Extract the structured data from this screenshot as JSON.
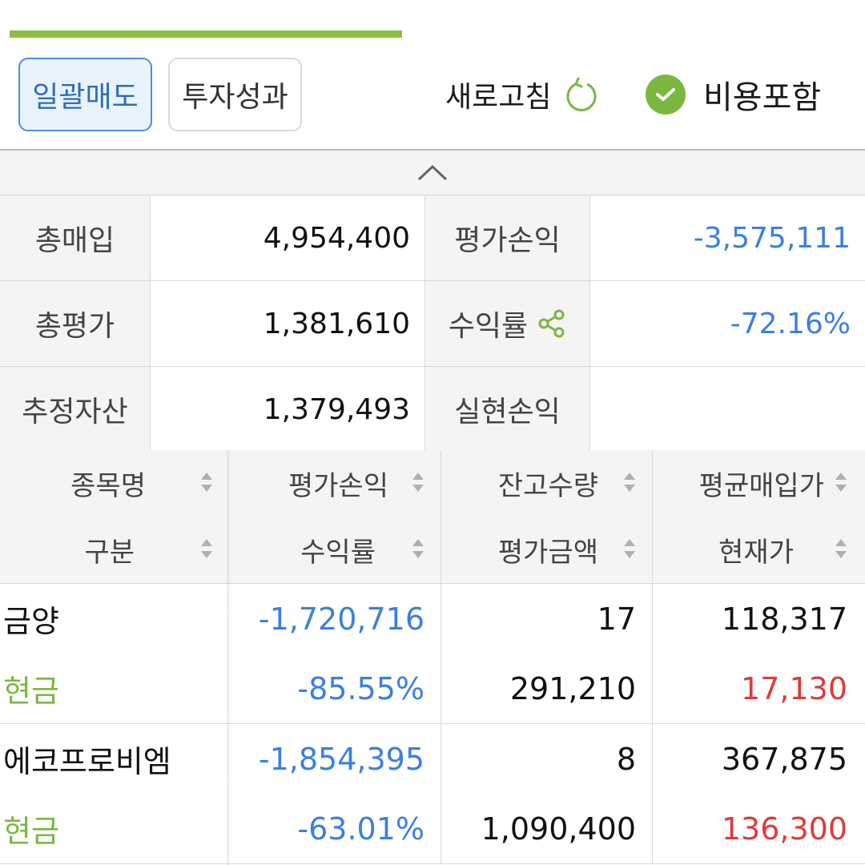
{
  "toolbar": {
    "bulk_sell": "일괄매도",
    "performance": "투자성과",
    "refresh": "새로고침",
    "include_fees": "비용포함"
  },
  "colors": {
    "accent": "#8cbf3f",
    "negative": "#3b7fe0",
    "price_up": "#e03a3a",
    "cash": "#7ab840"
  },
  "summary": {
    "rows": [
      {
        "label1": "총매입",
        "value1": "4,954,400",
        "label2": "평가손익",
        "value2": "-3,575,111"
      },
      {
        "label1": "총평가",
        "value1": "1,381,610",
        "label2": "수익률",
        "value2": "-72.16%"
      },
      {
        "label1": "추정자산",
        "value1": "1,379,493",
        "label2": "실현손익",
        "value2": ""
      }
    ]
  },
  "table": {
    "headers_top": [
      "종목명",
      "평가손익",
      "잔고수량",
      "평균매입가"
    ],
    "headers_bottom": [
      "구분",
      "수익률",
      "평가금액",
      "현재가"
    ],
    "rows": [
      {
        "name": "금양",
        "type": "현금",
        "pnl": "-1,720,716",
        "rate": "-85.55%",
        "qty": "17",
        "eval": "291,210",
        "avg": "118,317",
        "price": "17,130"
      },
      {
        "name": "에코프로비엠",
        "type": "현금",
        "pnl": "-1,854,395",
        "rate": "-63.01%",
        "qty": "8",
        "eval": "1,090,400",
        "avg": "367,875",
        "price": "136,300"
      }
    ]
  }
}
